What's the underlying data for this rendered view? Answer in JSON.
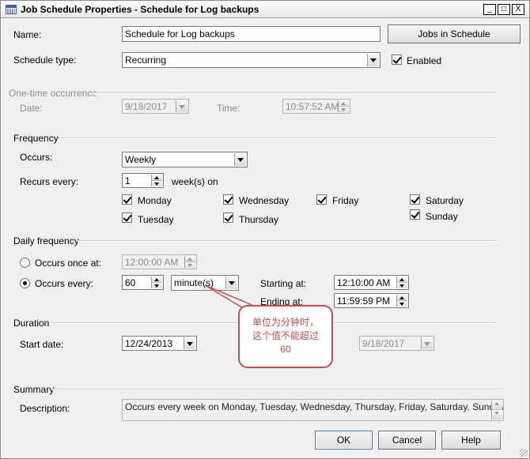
{
  "window": {
    "title": "Job Schedule Properties - Schedule for Log backups",
    "minimize_glyph": "_",
    "maximize_glyph": "□",
    "close_glyph": "X"
  },
  "general": {
    "name_label": "Name:",
    "name_value": "Schedule for Log backups",
    "jobs_button": "Jobs in Schedule",
    "schedule_type_label": "Schedule type:",
    "schedule_type_value": "Recurring",
    "enabled_label": "Enabled",
    "enabled_checked": true
  },
  "one_time": {
    "header": "One-time occurrence",
    "date_label": "Date:",
    "date_value": "9/18/2017",
    "time_label": "Time:",
    "time_value": "10:57:52 AM"
  },
  "frequency": {
    "header": "Frequency",
    "occurs_label": "Occurs:",
    "occurs_value": "Weekly",
    "recurs_label": "Recurs every:",
    "recurs_value": "1",
    "recurs_unit": "week(s) on",
    "days": [
      {
        "label": "Monday",
        "checked": true
      },
      {
        "label": "Wednesday",
        "checked": true
      },
      {
        "label": "Friday",
        "checked": true
      },
      {
        "label": "Saturday",
        "checked": true
      },
      {
        "label": "Tuesday",
        "checked": true
      },
      {
        "label": "Thursday",
        "checked": true
      },
      {
        "label": "Sunday",
        "checked": true
      }
    ]
  },
  "daily": {
    "header": "Daily frequency",
    "once_label": "Occurs once at:",
    "once_value": "12:00:00 AM",
    "every_label": "Occurs every:",
    "every_value": "60",
    "every_unit": "minute(s)",
    "starting_label": "Starting at:",
    "starting_value": "12:10:00 AM",
    "ending_label": "Ending at:",
    "ending_value": "11:59:59 PM",
    "selected": "every"
  },
  "duration": {
    "header": "Duration",
    "start_label": "Start date:",
    "start_value": "12/24/2013",
    "end_value": "9/18/2017"
  },
  "summary": {
    "header": "Summary",
    "description_label": "Description:",
    "description_value": "Occurs every week on Monday, Tuesday, Wednesday, Thursday, Friday, Saturday, Sunday every"
  },
  "buttons": {
    "ok": "OK",
    "cancel": "Cancel",
    "help": "Help"
  },
  "annotation": {
    "line1": "单位为分钟时，",
    "line2": "这个值不能超过",
    "line3": "60",
    "color": "#c0504d"
  }
}
